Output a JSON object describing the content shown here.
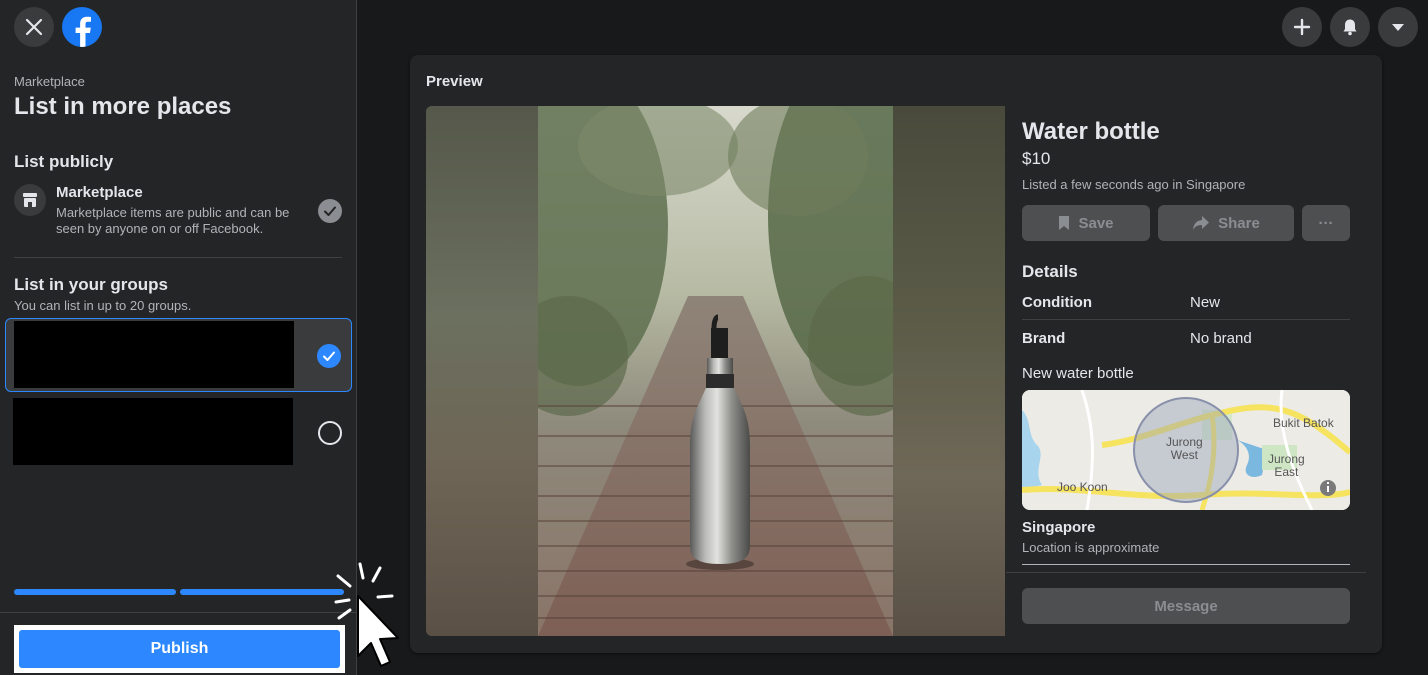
{
  "header": {
    "close_icon": "close-icon",
    "logo_icon": "facebook-logo-icon"
  },
  "sidebar": {
    "breadcrumb": "Marketplace",
    "title": "List in more places",
    "list_publicly": {
      "heading": "List publicly",
      "item_name": "Marketplace",
      "item_description": "Marketplace items are public and can be seen by anyone on or off Facebook."
    },
    "groups": {
      "heading": "List in your groups",
      "subtitle": "You can list in up to 20 groups.",
      "items": [
        {
          "selected": true
        },
        {
          "selected": false
        }
      ]
    },
    "progress_steps_completed": 2,
    "progress_steps_total": 2,
    "publish_label": "Publish"
  },
  "topbar": {
    "icons": [
      "plus-icon",
      "bell-icon",
      "caret-down-icon"
    ]
  },
  "preview": {
    "label": "Preview",
    "listing": {
      "title": "Water bottle",
      "price": "$10",
      "meta": "Listed a few seconds ago in Singapore",
      "save_label": "Save",
      "share_label": "Share",
      "more_label": "···",
      "details_heading": "Details",
      "details": [
        {
          "key": "Condition",
          "value": "New"
        },
        {
          "key": "Brand",
          "value": "No brand"
        }
      ],
      "description": "New water bottle",
      "map_labels": {
        "jurong_west": "Jurong\nWest",
        "bukit_batok": "Bukit Batok",
        "jurong_east": "Jurong\nEast",
        "joo_koon": "Joo Koon"
      },
      "location": "Singapore",
      "location_note": "Location is approximate",
      "message_label": "Message"
    }
  },
  "colors": {
    "accent": "#2d88ff",
    "background": "#18191a",
    "panel": "#242526"
  }
}
